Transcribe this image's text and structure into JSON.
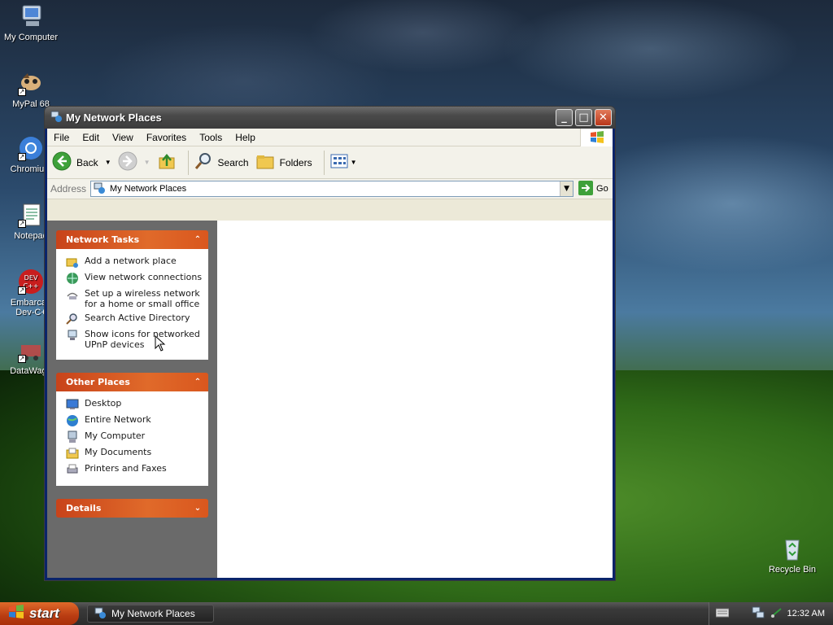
{
  "desktop": {
    "icons": [
      {
        "label": "My Computer",
        "icon": "computer-icon"
      },
      {
        "label": "MyPal 68",
        "icon": "mypal-icon"
      },
      {
        "label": "Chromium",
        "icon": "chromium-icon"
      },
      {
        "label": "Notepad",
        "icon": "notepad-icon"
      },
      {
        "label": "Embarcadero Dev-C++",
        "line1": "Embarcad",
        "line2": "Dev-C+",
        "icon": "devcpp-icon"
      },
      {
        "label": "DataWago",
        "icon": "datawago-icon"
      },
      {
        "label": "Recycle Bin",
        "icon": "recycle-bin-icon"
      }
    ]
  },
  "window": {
    "title": "My Network Places",
    "menu": [
      "File",
      "Edit",
      "View",
      "Favorites",
      "Tools",
      "Help"
    ],
    "toolbar": {
      "back": "Back",
      "search": "Search",
      "folders": "Folders"
    },
    "address": {
      "label": "Address",
      "value": "My Network Places",
      "go": "Go"
    },
    "panels": {
      "network_tasks": {
        "title": "Network Tasks",
        "items": [
          {
            "line1": "Add a network place",
            "line2": "",
            "icon": "add-network-place-icon"
          },
          {
            "line1": "View network connections",
            "line2": "",
            "icon": "network-connections-icon"
          },
          {
            "line1": "Set up a wireless network",
            "line2": "for a home or small office",
            "icon": "wireless-icon"
          },
          {
            "line1": "Search Active Directory",
            "line2": "",
            "icon": "search-directory-icon"
          },
          {
            "line1": "Show icons for networked",
            "line2": "UPnP devices",
            "icon": "upnp-icon"
          }
        ]
      },
      "other_places": {
        "title": "Other Places",
        "items": [
          {
            "line1": "Desktop",
            "icon": "desktop-icon"
          },
          {
            "line1": "Entire Network",
            "icon": "entire-network-icon"
          },
          {
            "line1": "My Computer",
            "icon": "my-computer-icon"
          },
          {
            "line1": "My Documents",
            "icon": "my-documents-icon"
          },
          {
            "line1": "Printers and Faxes",
            "icon": "printers-icon"
          }
        ]
      },
      "details": {
        "title": "Details"
      }
    }
  },
  "taskbar": {
    "start": "start",
    "task_button": "My Network Places",
    "clock": "12:32 AM"
  }
}
